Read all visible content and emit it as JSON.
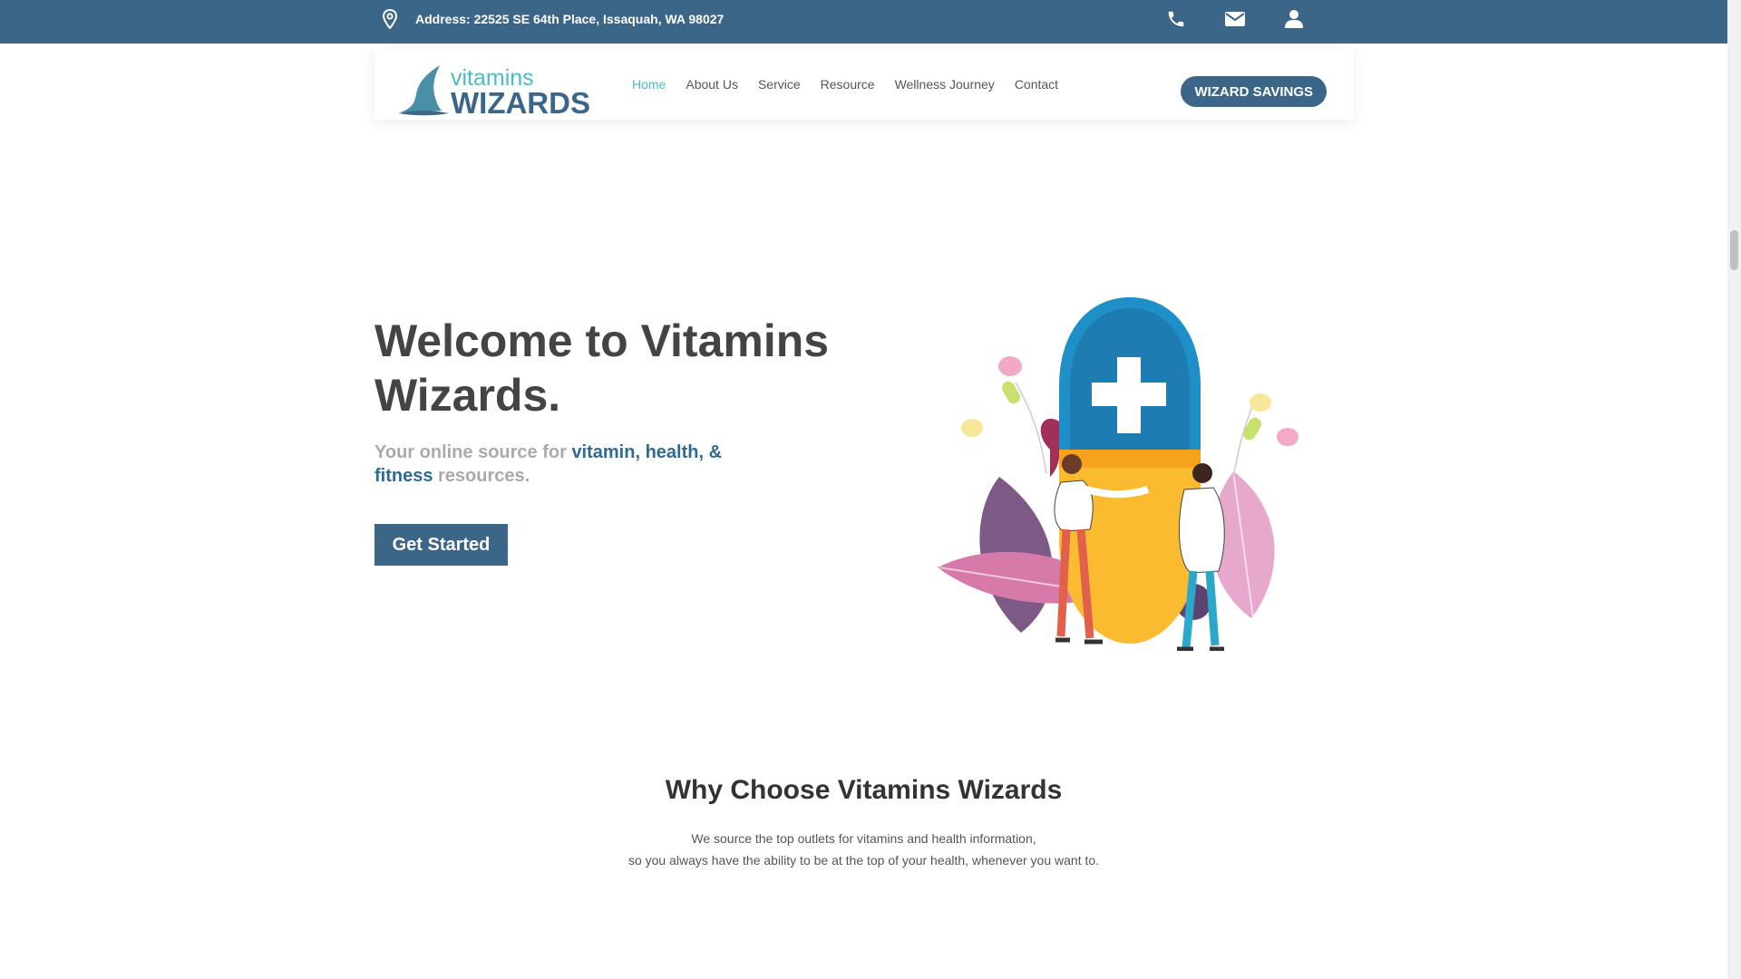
{
  "topbar": {
    "address": "Address: 22525 SE 64th Place, Issaquah, WA 98027",
    "icons": [
      "map-marker-icon",
      "phone-icon",
      "envelope-icon",
      "user-icon"
    ]
  },
  "logo": {
    "line1": "vitamins",
    "line2": "WIZARDS"
  },
  "nav": {
    "items": [
      {
        "label": "Home",
        "active": true
      },
      {
        "label": "About Us",
        "active": false
      },
      {
        "label": "Service",
        "active": false
      },
      {
        "label": "Resource",
        "active": false
      },
      {
        "label": "Wellness Journey",
        "active": false
      },
      {
        "label": "Contact",
        "active": false
      }
    ],
    "cta": "WIZARD SAVINGS"
  },
  "hero": {
    "title": "Welcome to Vitamins Wizards.",
    "subtitle_a": "Your online source for ",
    "subtitle_hl": "vitamin, health, & fitness",
    "subtitle_b": " resources.",
    "button": "Get Started"
  },
  "why": {
    "title": "Why Choose Vitamins Wizards",
    "line1": "We source the top outlets for vitamins and health information,",
    "line2": "so you always have the ability to be at the top of your health, whenever you want to."
  },
  "colors": {
    "brand": "#3b6687",
    "accent": "#4dbac5",
    "highlight": "#2e6a91",
    "capsule_blue": "#1e8fc7",
    "capsule_yellow": "#fbbb31"
  }
}
